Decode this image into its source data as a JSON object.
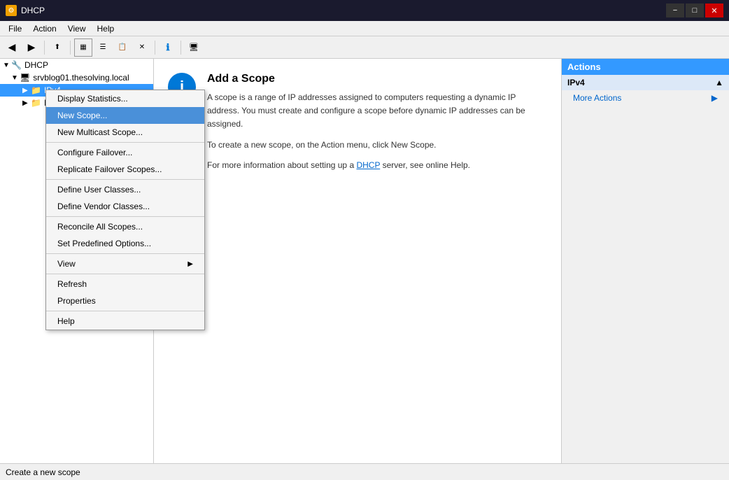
{
  "titleBar": {
    "icon": "🔧",
    "title": "DHCP",
    "minimizeLabel": "−",
    "maximizeLabel": "□",
    "closeLabel": "✕"
  },
  "menuBar": {
    "items": [
      "File",
      "Action",
      "View",
      "Help"
    ]
  },
  "toolbar": {
    "buttons": [
      "◀",
      "▶",
      "⬆",
      "📋",
      "📄",
      "🗑",
      "⊕",
      "🖥",
      "📡",
      "💻"
    ]
  },
  "tree": {
    "root": {
      "label": "DHCP",
      "children": [
        {
          "label": "srvblog01.thesolving.local",
          "children": [
            {
              "label": "IPv4",
              "selected": true
            },
            {
              "label": "IPv6"
            }
          ]
        }
      ]
    }
  },
  "content": {
    "title": "Add a Scope",
    "paragraphs": [
      "A scope is a range of IP addresses assigned to computers requesting a dynamic IP address. You must create and configure a scope before dynamic IP addresses can be assigned.",
      "To create a new scope, on the Action menu, click New Scope.",
      "For more information about setting up a DHCP server, see online Help."
    ],
    "linkText": "DHCP"
  },
  "actions": {
    "title": "Actions",
    "section": "IPv4",
    "sectionArrow": "▲",
    "items": [
      {
        "label": "More Actions",
        "hasArrow": true
      }
    ]
  },
  "statusBar": {
    "text": "Create a new scope"
  },
  "contextMenu": {
    "items": [
      {
        "label": "Display Statistics...",
        "type": "normal"
      },
      {
        "label": "New Scope...",
        "type": "highlighted"
      },
      {
        "label": "New Multicast Scope...",
        "type": "normal"
      },
      {
        "type": "separator"
      },
      {
        "label": "Configure Failover...",
        "type": "normal"
      },
      {
        "label": "Replicate Failover Scopes...",
        "type": "normal"
      },
      {
        "type": "separator"
      },
      {
        "label": "Define User Classes...",
        "type": "normal"
      },
      {
        "label": "Define Vendor Classes...",
        "type": "normal"
      },
      {
        "type": "separator"
      },
      {
        "label": "Reconcile All Scopes...",
        "type": "normal"
      },
      {
        "label": "Set Predefined Options...",
        "type": "normal"
      },
      {
        "type": "separator"
      },
      {
        "label": "View",
        "type": "normal",
        "hasArrow": true
      },
      {
        "type": "separator"
      },
      {
        "label": "Refresh",
        "type": "normal"
      },
      {
        "label": "Properties",
        "type": "normal"
      },
      {
        "type": "separator"
      },
      {
        "label": "Help",
        "type": "normal"
      }
    ]
  }
}
